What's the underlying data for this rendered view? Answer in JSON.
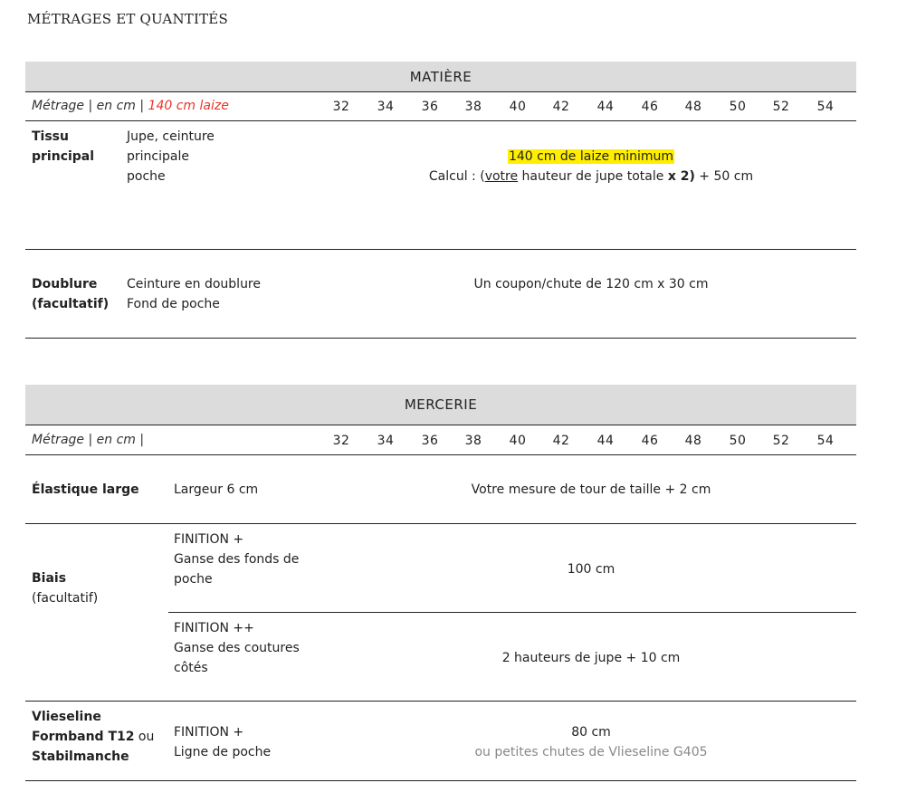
{
  "title": "MÉTRAGES ET QUANTITÉS",
  "sizes": [
    "32",
    "34",
    "36",
    "38",
    "40",
    "42",
    "44",
    "46",
    "48",
    "50",
    "52",
    "54"
  ],
  "matiere": {
    "band": "MATIÈRE",
    "header_label": "Métrage | en cm |",
    "header_red": "140 cm laize",
    "rows": [
      {
        "name": [
          "Tissu",
          "principal"
        ],
        "desc": [
          "Jupe, ceinture",
          "principale",
          "poche"
        ],
        "highlight": "140 cm de laize minimum",
        "calc_prefix": "Calcul : (",
        "calc_underline": "votre",
        "calc_mid": " hauteur de jupe totale ",
        "calc_bold": "x 2)",
        "calc_suffix": " + 50 cm"
      },
      {
        "name": [
          "Doublure",
          "(facultatif)"
        ],
        "desc": [
          "Ceinture en doublure",
          "Fond de poche"
        ],
        "value": "Un coupon/chute de 120 cm x 30 cm"
      }
    ]
  },
  "mercerie": {
    "band": "MERCERIE",
    "header_label": "Métrage | en cm |",
    "rows": [
      {
        "name": "Élastique large",
        "desc": "Largeur 6 cm",
        "value": "Votre mesure de tour de taille + 2 cm"
      },
      {
        "name": "Biais",
        "name_sub": "(facultatif)",
        "subrows": [
          {
            "desc": [
              "FINITION +",
              "Ganse des fonds de",
              "poche"
            ],
            "value": "100 cm"
          },
          {
            "desc": [
              "FINITION ++",
              "Ganse des coutures",
              "côtés"
            ],
            "value": "2 hauteurs de jupe + 10 cm"
          }
        ]
      },
      {
        "name": [
          "Vlieseline",
          "Formband T12",
          "Stabilmanche"
        ],
        "name_ou": " ou",
        "desc": [
          "FINITION +",
          "Ligne de poche"
        ],
        "value": "80 cm",
        "value_sub": "ou petites chutes de Vlieseline G405"
      }
    ]
  }
}
